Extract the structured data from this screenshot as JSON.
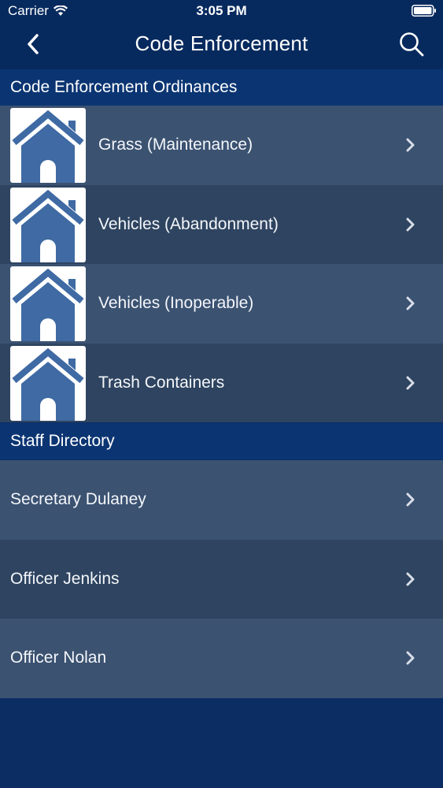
{
  "status_bar": {
    "carrier": "Carrier",
    "time": "3:05 PM",
    "icons": [
      "wifi-icon",
      "battery-icon"
    ]
  },
  "nav": {
    "title": "Code Enforcement",
    "icons": [
      "back-chevron-icon",
      "search-icon"
    ]
  },
  "sections": {
    "ordinances": {
      "header": "Code Enforcement Ordinances",
      "items": [
        {
          "label": "Grass (Maintenance)",
          "icon": "house-icon"
        },
        {
          "label": "Vehicles (Abandonment)",
          "icon": "house-icon"
        },
        {
          "label": "Vehicles (Inoperable)",
          "icon": "house-icon"
        },
        {
          "label": "Trash Containers",
          "icon": "house-icon"
        }
      ]
    },
    "staff": {
      "header": "Staff Directory",
      "items": [
        {
          "label": "Secretary Dulaney"
        },
        {
          "label": "Officer Jenkins"
        },
        {
          "label": "Officer Nolan"
        }
      ]
    }
  },
  "colors": {
    "background": "#0b2d63",
    "bar": "#072a5e",
    "section_header": "#0b3572",
    "row_light": "#3b5271",
    "row_dark": "#2e4460",
    "house_blue": "#3f6aa3"
  }
}
